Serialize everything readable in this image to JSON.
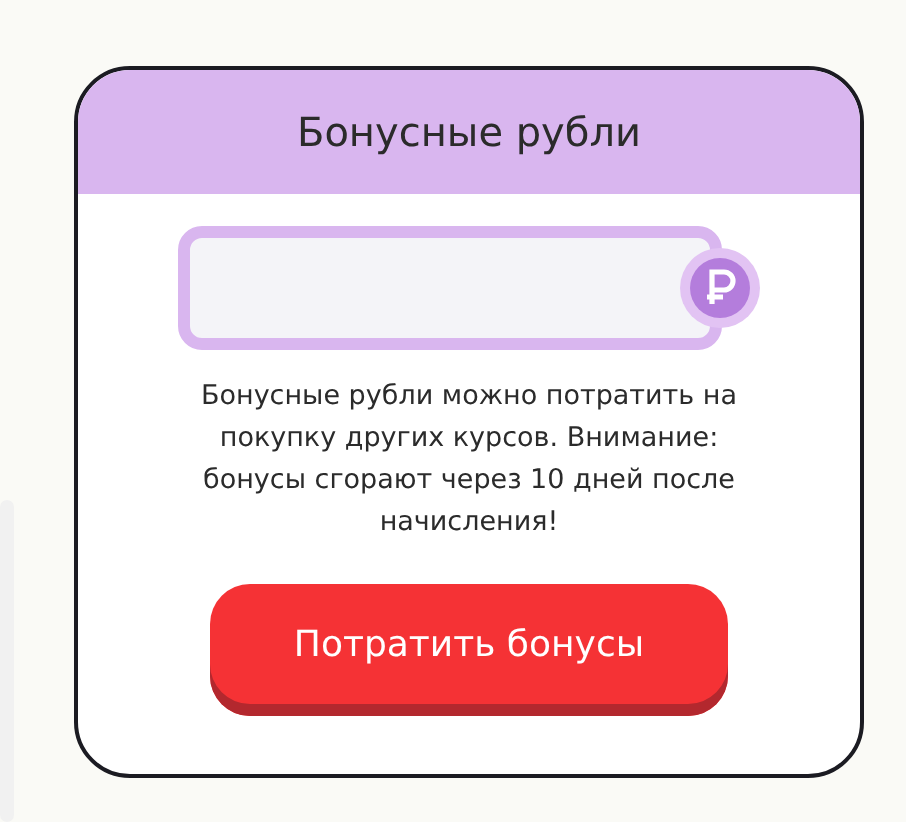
{
  "card": {
    "title": "Бонусные рубли",
    "description": "Бонусные рубли можно потратить на покупку других курсов. Внимание: бонусы сгорают через 10 дней после начисления!",
    "button": "Потратить бонусы"
  }
}
